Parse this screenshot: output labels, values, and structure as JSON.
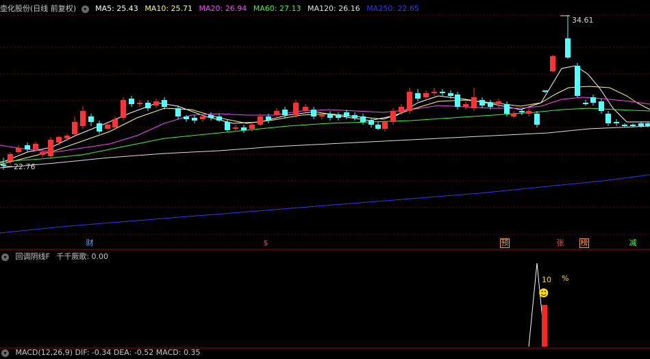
{
  "main_chart": {
    "stock_label": "壶化股份(日线 前复权)",
    "ma_values": [
      {
        "label": "MA5: 25.43",
        "color": "#ffffff"
      },
      {
        "label": "MA10: 25.71",
        "color": "#ffff66"
      },
      {
        "label": "MA20: 26.94",
        "color": "#ff44ff"
      },
      {
        "label": "MA60: 27.13",
        "color": "#33ff33"
      },
      {
        "label": "MA120: 26.16",
        "color": "#e0e0e0"
      },
      {
        "label": "MA250: 22.65",
        "color": "#3333ff"
      }
    ],
    "high_price_label": "34.61",
    "low_price_label": "22.76",
    "event_tags": [
      {
        "text": "财",
        "color": "#55aaff"
      },
      {
        "text": "$",
        "color": "#ff4444"
      },
      {
        "text": "预",
        "color": "#ff9933"
      },
      {
        "text": "张",
        "color": "#ff5555"
      },
      {
        "text": "榜",
        "color": "#ff9933"
      },
      {
        "text": "减",
        "color": "#55ff55"
      }
    ],
    "colors": {
      "up": "#ff3333",
      "down": "#54ffff",
      "grid": "#7a0000"
    }
  },
  "indicator_panel": {
    "title": "回调阴线F",
    "value_label": "千千厥歌: 0.00",
    "peak_label": "10",
    "percent_label": "%",
    "smiley": "☻"
  },
  "macd_panel": {
    "label": "MACD(12,26,9) DIF: -0.34 DEA: -0.52 MACD: 0.35"
  }
}
